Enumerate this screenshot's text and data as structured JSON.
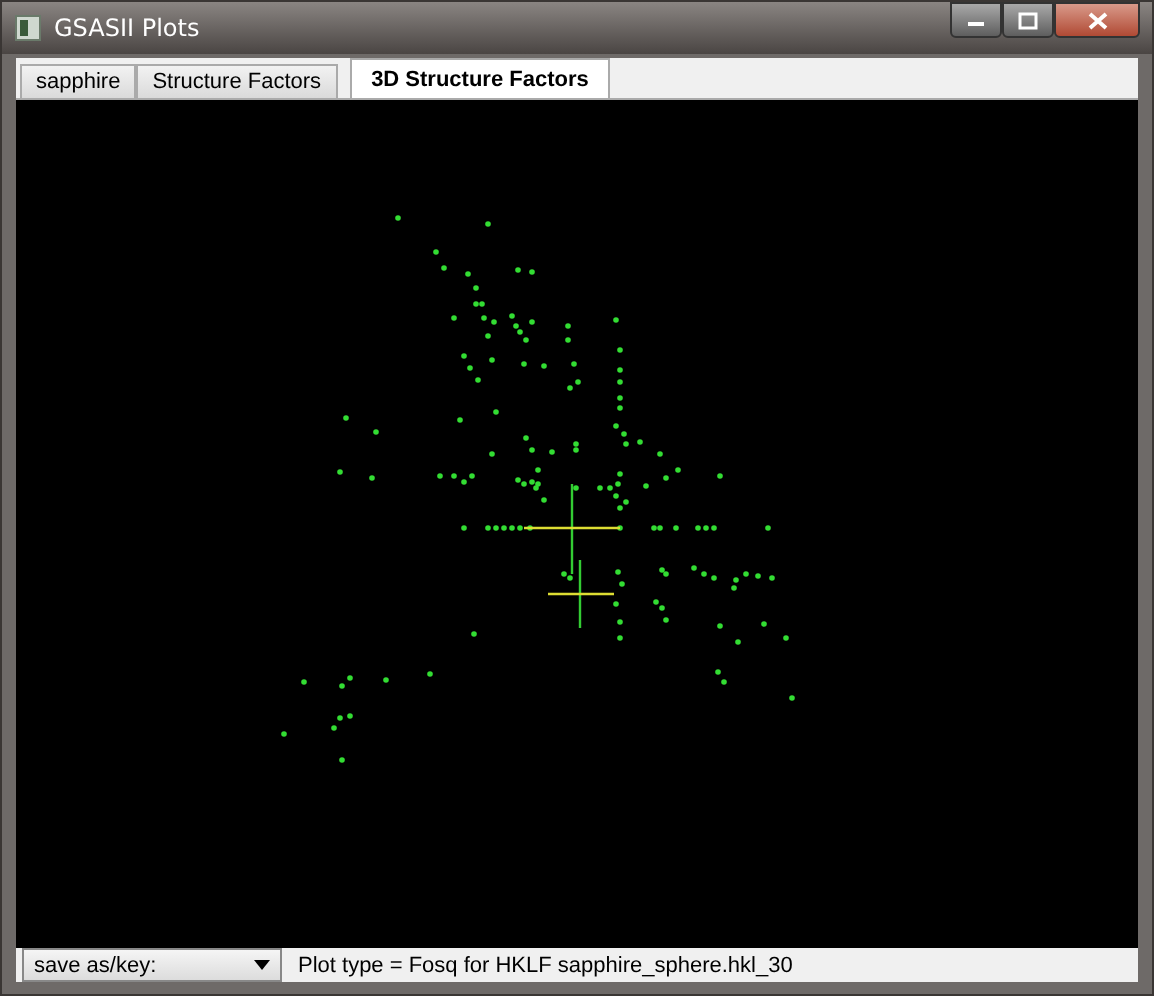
{
  "window": {
    "title": "GSASII Plots"
  },
  "tabs": [
    {
      "label": "sapphire",
      "selected": false
    },
    {
      "label": "Structure Factors",
      "selected": false
    },
    {
      "label": "3D Structure Factors",
      "selected": true
    }
  ],
  "bottom_bar": {
    "save_dropdown": "save as/key:",
    "status": "Plot type = Fosq for HKLF sapphire_sphere.hkl_30"
  }
}
